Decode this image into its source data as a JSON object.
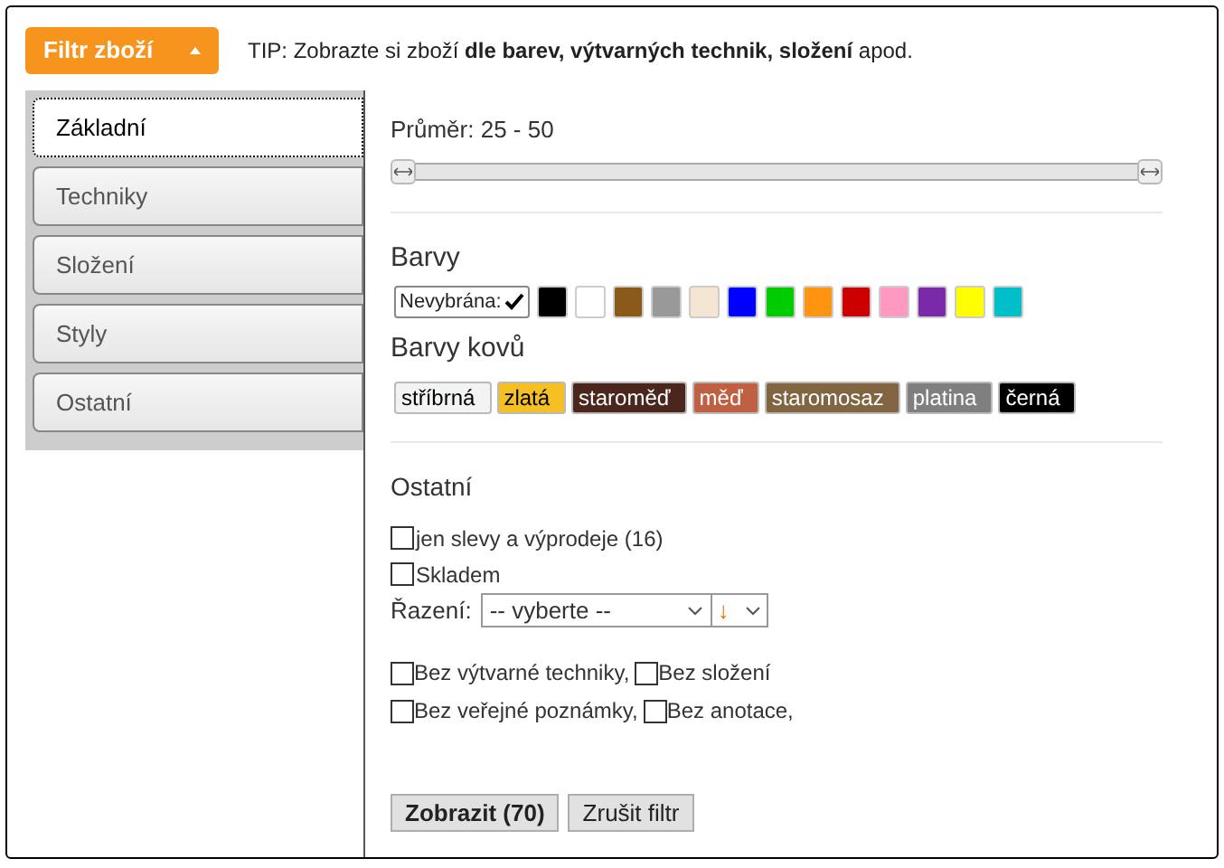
{
  "header": {
    "filter_button": "Filtr zboží",
    "tip": "TIP: Zobrazte si zboží **dle barev, výtvarných technik, složení** apod."
  },
  "sidebar": {
    "items": [
      {
        "label": "Základní",
        "selected": true
      },
      {
        "label": "Techniky",
        "selected": false
      },
      {
        "label": "Složení",
        "selected": false
      },
      {
        "label": "Styly",
        "selected": false
      },
      {
        "label": "Ostatní",
        "selected": false
      }
    ]
  },
  "diameter": {
    "label": "Průměr: 25 - 50",
    "handles": [
      {
        "level": 0
      },
      {
        "level": 1
      }
    ]
  },
  "colors": {
    "title": "Barvy",
    "items": [
      {
        "kind": "none",
        "label": "Nevybrána:",
        "selected": true
      },
      {
        "kind": "swatch",
        "color": "#000000",
        "selected": false
      },
      {
        "kind": "swatch",
        "color": "#ffffff",
        "selected": false
      },
      {
        "kind": "swatch",
        "color": "#8b5a1a",
        "selected": false
      },
      {
        "kind": "swatch",
        "color": "#999999",
        "selected": false
      },
      {
        "kind": "swatch",
        "color": "#f5e6d3",
        "selected": false
      },
      {
        "kind": "swatch",
        "color": "#0000ff",
        "selected": false
      },
      {
        "kind": "swatch",
        "color": "#00cc00",
        "selected": false
      },
      {
        "kind": "swatch",
        "color": "#ff9411",
        "selected": false
      },
      {
        "kind": "swatch",
        "color": "#cc0000",
        "selected": false
      },
      {
        "kind": "swatch",
        "color": "#ff99c2",
        "selected": false
      },
      {
        "kind": "swatch",
        "color": "#7a2aa8",
        "selected": false
      },
      {
        "kind": "swatch",
        "color": "#ffff00",
        "selected": false
      },
      {
        "kind": "swatch",
        "color": "#00bfc8",
        "selected": false
      }
    ]
  },
  "metal_colors": {
    "title": "Barvy kovů",
    "items": [
      {
        "label": "stříbrná",
        "color": "#f2f3f3"
      },
      {
        "label": "zlatá",
        "color": "#f5c023"
      },
      {
        "label": "staroměď",
        "color": "#4a261d"
      },
      {
        "label": "měď",
        "color": "#be6041"
      },
      {
        "label": "staromosaz",
        "color": "#816540"
      },
      {
        "label": "platina",
        "color": "#7f7f7f"
      },
      {
        "label": "černá",
        "color": "#000000"
      }
    ]
  },
  "other": {
    "title": "Ostatní",
    "options": [
      {
        "label": "jen slevy a výprodeje (16)",
        "checked": false
      },
      {
        "label": "Skladem",
        "checked": false
      }
    ],
    "sort": {
      "label": "Řazení:",
      "value": "-- vyberte --",
      "direction": "↓"
    },
    "extra_rows": [
      [
        {
          "label": "Bez výtvarné techniky,",
          "checked": false
        },
        {
          "label": "Bez složení",
          "checked": false
        }
      ],
      [
        {
          "label": "Bez veřejné poznámky,",
          "checked": false
        },
        {
          "label": "Bez anotace,",
          "checked": false
        }
      ]
    ]
  },
  "buttons": {
    "show": "Zobrazit (70)",
    "reset": "Zrušit filtr"
  }
}
